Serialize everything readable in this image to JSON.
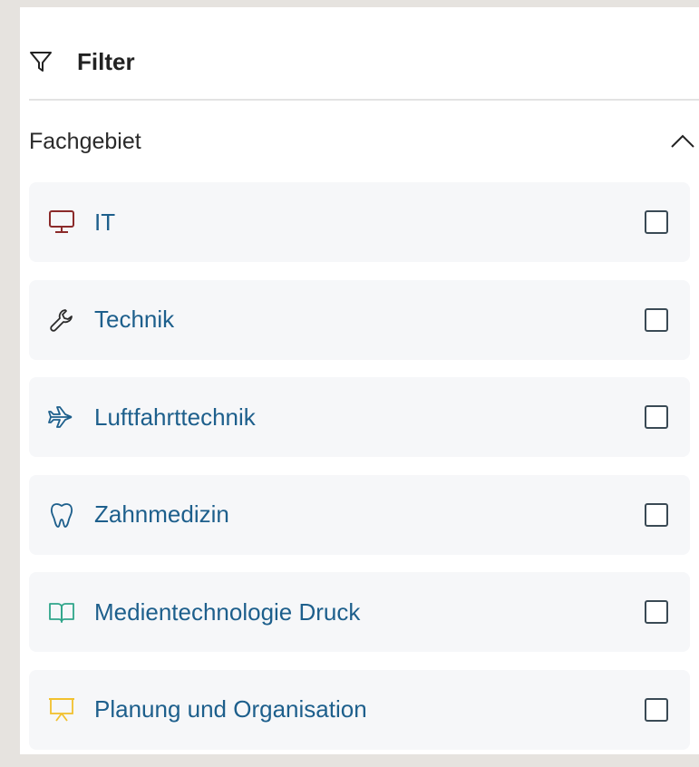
{
  "filter": {
    "title": "Filter",
    "icon": "filter-icon"
  },
  "section": {
    "title": "Fachgebiet",
    "expanded": true,
    "toggle_icon": "chevron-up-icon"
  },
  "items": [
    {
      "label": "IT",
      "icon": "monitor-icon",
      "color": "#8b2a2a",
      "checked": false
    },
    {
      "label": "Technik",
      "icon": "wrench-icon",
      "color": "#2b2b2b",
      "checked": false
    },
    {
      "label": "Luftfahrttechnik",
      "icon": "airplane-icon",
      "color": "#1d5f8c",
      "checked": false
    },
    {
      "label": "Zahnmedizin",
      "icon": "tooth-icon",
      "color": "#1d5f8c",
      "checked": false
    },
    {
      "label": "Medientechnologie Druck",
      "icon": "book-icon",
      "color": "#2fa58a",
      "checked": false
    },
    {
      "label": "Planung und Organisation",
      "icon": "presentation-board-icon",
      "color": "#f2c12e",
      "checked": false
    }
  ],
  "colors": {
    "label": "#1d5f8c",
    "item_bg": "#f6f7f9",
    "page_bg": "#e6e3df"
  }
}
